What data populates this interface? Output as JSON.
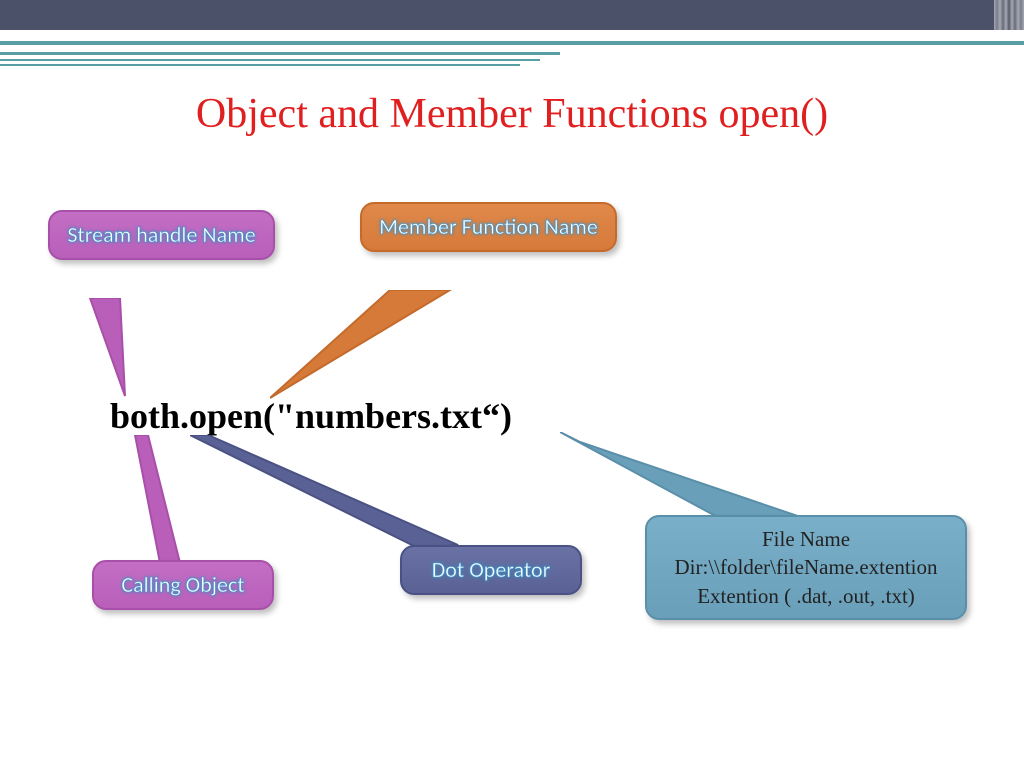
{
  "title": "Object and Member Functions open()",
  "code": "both.open(\"numbers.txt“)",
  "callouts": {
    "stream": "Stream handle Name",
    "member": "Member Function Name",
    "calling": "Calling Object",
    "dot": "Dot Operator",
    "file1": "File Name",
    "file2": "Dir:\\\\folder\\fileName.extention",
    "file3": "Extention ( .dat, .out, .txt)"
  }
}
